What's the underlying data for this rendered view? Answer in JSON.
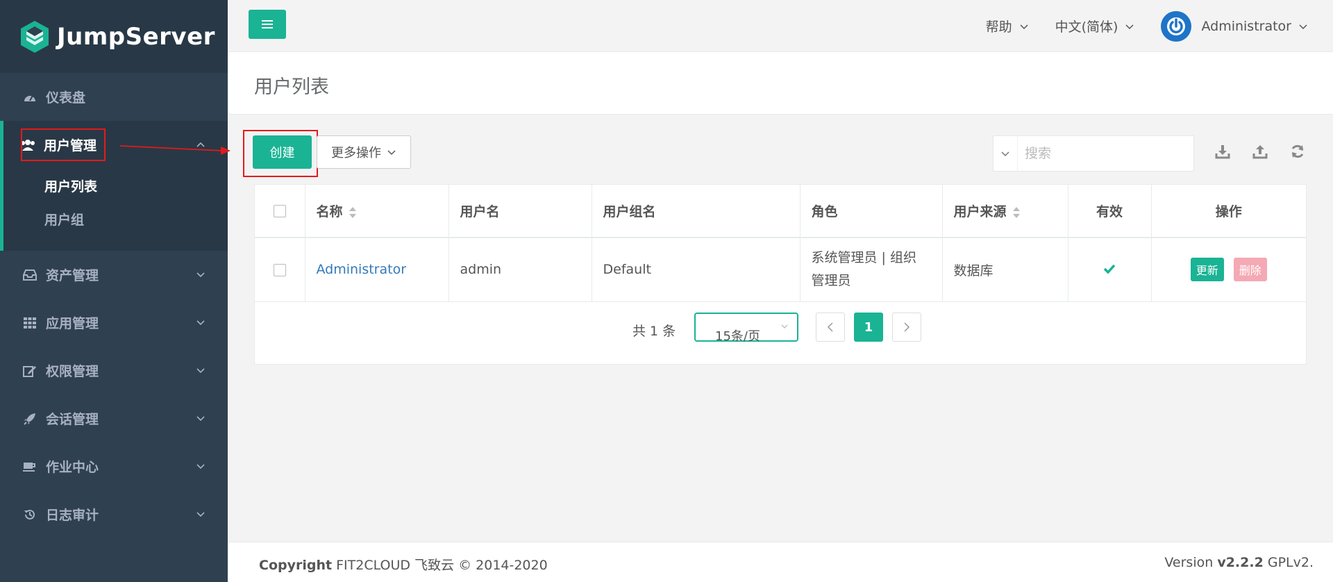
{
  "brand": {
    "name": "JumpServer"
  },
  "sidebar": {
    "items": [
      {
        "label": "仪表盘",
        "icon": "dashboard-icon"
      },
      {
        "label": "用户管理",
        "icon": "users-icon",
        "active": true,
        "children": [
          {
            "label": "用户列表",
            "current": true
          },
          {
            "label": "用户组"
          }
        ]
      },
      {
        "label": "资产管理",
        "icon": "inbox-icon"
      },
      {
        "label": "应用管理",
        "icon": "grid-icon"
      },
      {
        "label": "权限管理",
        "icon": "edit-icon"
      },
      {
        "label": "会话管理",
        "icon": "rocket-icon"
      },
      {
        "label": "作业中心",
        "icon": "coffee-icon"
      },
      {
        "label": "日志审计",
        "icon": "history-icon"
      }
    ]
  },
  "topbar": {
    "help": "帮助",
    "language": "中文(简体)",
    "user": "Administrator"
  },
  "page": {
    "title": "用户列表"
  },
  "toolbar": {
    "create": "创建",
    "more_actions": "更多操作",
    "search_placeholder": "搜索"
  },
  "table": {
    "columns": [
      "名称",
      "用户名",
      "用户组名",
      "角色",
      "用户来源",
      "有效",
      "操作"
    ],
    "rows": [
      {
        "name": "Administrator",
        "username": "admin",
        "group": "Default",
        "role": "系统管理员 | 组织管理员",
        "source": "数据库",
        "valid": true,
        "update": "更新",
        "delete": "删除"
      }
    ]
  },
  "pagination": {
    "total": "共 1 条",
    "page_size": "15条/页",
    "current_page": "1"
  },
  "footer": {
    "copyright_label": "Copyright",
    "copyright_text": "FIT2CLOUD 飞致云 © 2014-2020",
    "version_label": "Version",
    "version": "v2.2.2",
    "license": "GPLv2."
  },
  "colors": {
    "accent": "#1ab394",
    "sidebar": "#2f4050",
    "annotation": "#e21b1b",
    "link": "#337ab7",
    "danger_light": "#f4a9b4"
  }
}
